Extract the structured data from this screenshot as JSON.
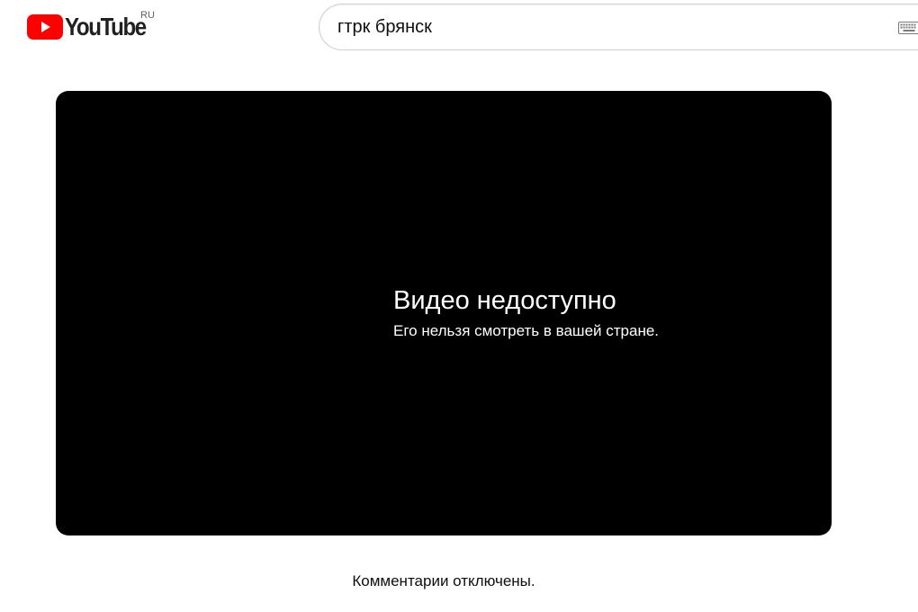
{
  "header": {
    "logo_text": "YouTube",
    "logo_country": "RU",
    "brand_color": "#ff0000",
    "logo_icon": "youtube-play-icon"
  },
  "search": {
    "value": "гтрк брянск",
    "keyboard_icon": "keyboard-icon"
  },
  "player": {
    "error_title": "Видео недоступно",
    "error_reason": "Его нельзя смотреть в вашей стране.",
    "background_color": "#000000"
  },
  "comments": {
    "status": "Комментарии отключены."
  }
}
